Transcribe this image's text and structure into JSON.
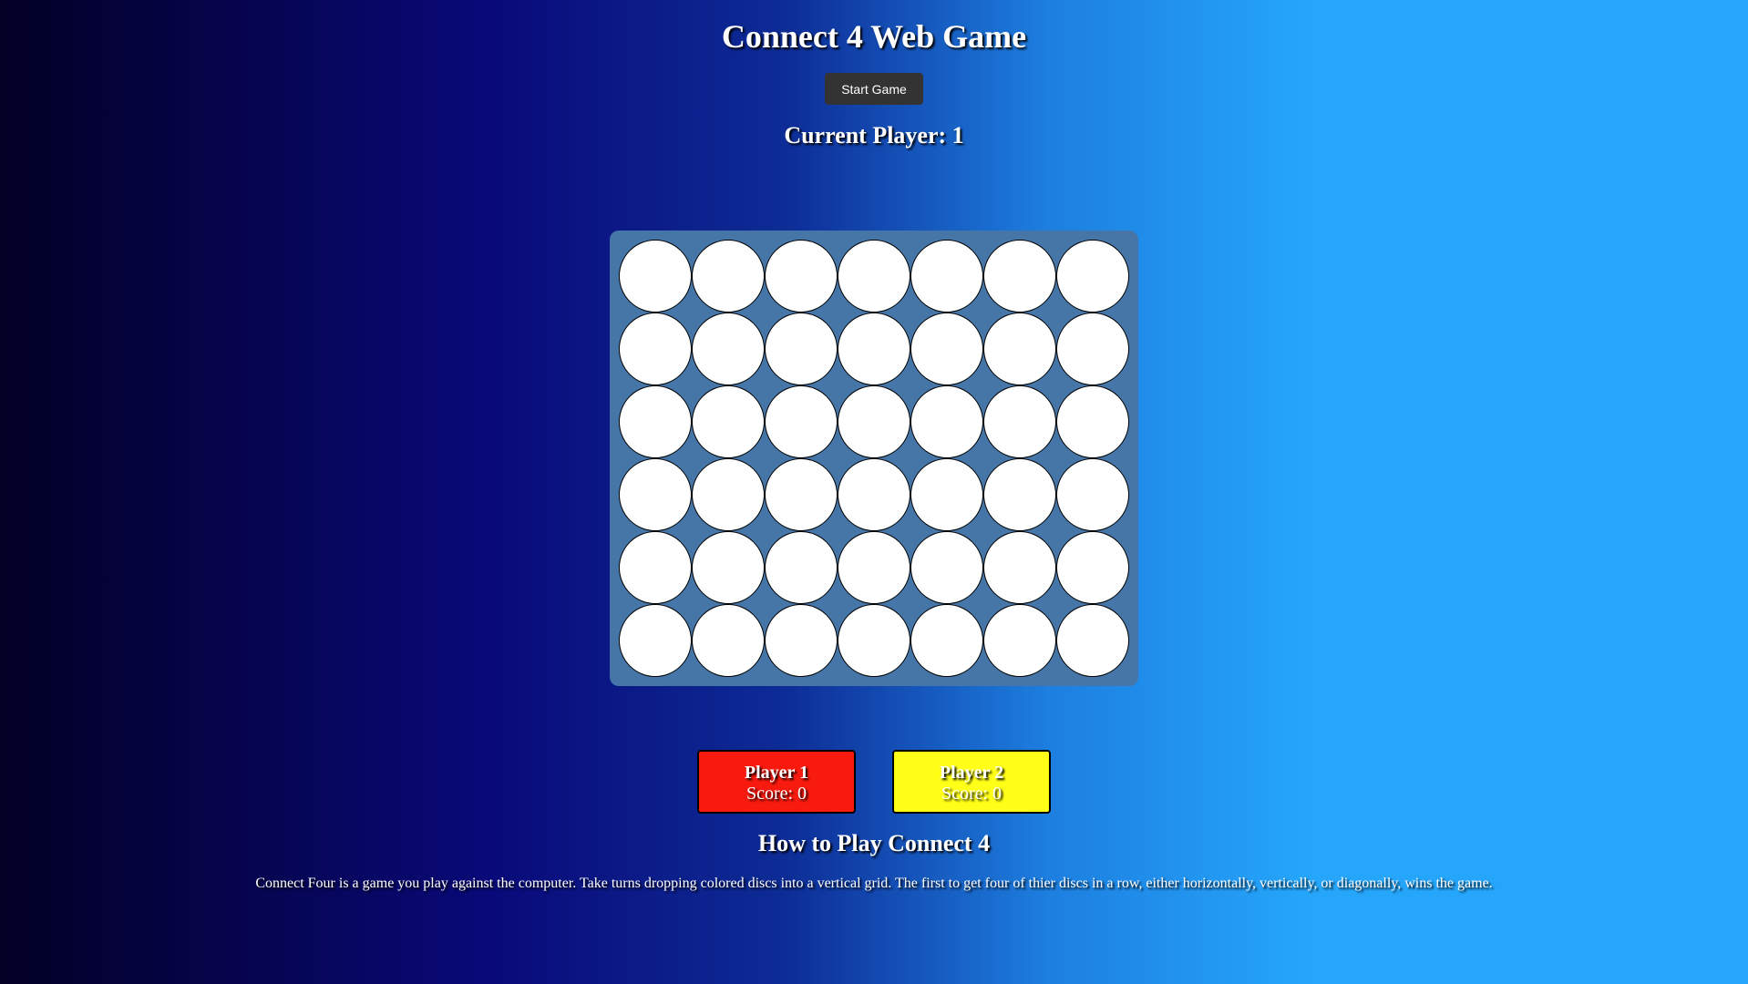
{
  "header": {
    "title": "Connect 4 Web Game",
    "start_button_label": "Start Game",
    "current_player_text": "Current Player: 1"
  },
  "board": {
    "rows": 6,
    "columns": 7,
    "cells": [
      [
        "empty",
        "empty",
        "empty",
        "empty",
        "empty",
        "empty",
        "empty"
      ],
      [
        "empty",
        "empty",
        "empty",
        "empty",
        "empty",
        "empty",
        "empty"
      ],
      [
        "empty",
        "empty",
        "empty",
        "empty",
        "empty",
        "empty",
        "empty"
      ],
      [
        "empty",
        "empty",
        "empty",
        "empty",
        "empty",
        "empty",
        "empty"
      ],
      [
        "empty",
        "empty",
        "empty",
        "empty",
        "empty",
        "empty",
        "empty"
      ],
      [
        "empty",
        "empty",
        "empty",
        "empty",
        "empty",
        "empty",
        "empty"
      ]
    ],
    "board_color": "#4675a8",
    "empty_color": "#ffffff"
  },
  "scoreboard": {
    "player1": {
      "name": "Player 1",
      "score_text": "Score: 0",
      "color": "#f81a0e"
    },
    "player2": {
      "name": "Player 2",
      "score_text": "Score: 0",
      "color": "#ffff17"
    }
  },
  "instructions": {
    "title": "How to Play Connect 4",
    "text": "Connect Four is a game you play against the computer. Take turns dropping colored discs into a vertical grid. The first to get four of thier discs in a row, either horizontally, vertically, or diagonally, wins the game."
  }
}
